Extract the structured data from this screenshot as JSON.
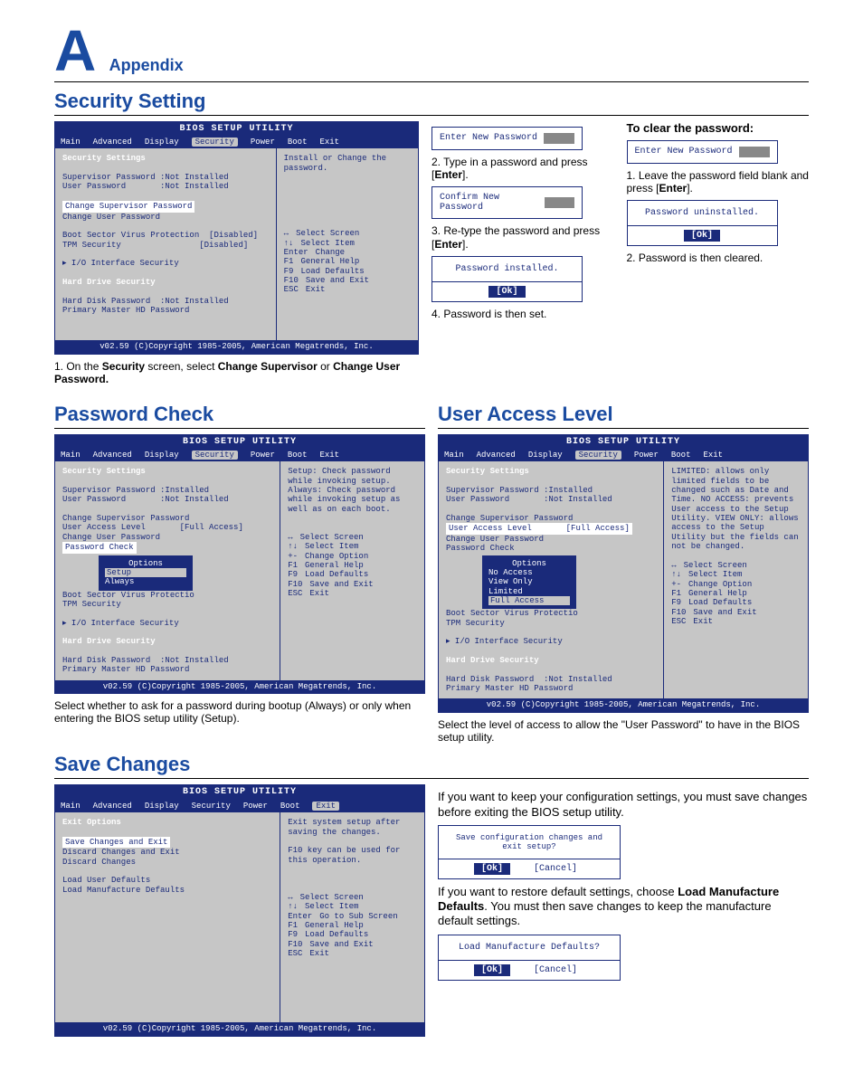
{
  "appendix": {
    "letter": "A",
    "label": "Appendix"
  },
  "sections": {
    "security": "Security Setting",
    "passwordCheck": "Password Check",
    "userAccess": "User Access Level",
    "saveChanges": "Save Changes"
  },
  "bios": {
    "title": "BIOS SETUP UTILITY",
    "menus": [
      "Main",
      "Advanced",
      "Display",
      "Security",
      "Power",
      "Boot",
      "Exit"
    ],
    "copyright": "v02.59 (C)Copyright 1985-2005, American Megatrends, Inc.",
    "keys": {
      "selectScreen": "Select Screen",
      "selectItem": "Select Item",
      "change": "Change",
      "changeOption": "Change Option",
      "generalHelp": "General Help",
      "loadDefaults": "Load Defaults",
      "saveExit": "Save and Exit",
      "exit": "Exit",
      "goSub": "Go to Sub Screen"
    }
  },
  "securityBios": {
    "heading": "Security Settings",
    "rows": [
      {
        "k": "Supervisor Password",
        "v": ":Not Installed"
      },
      {
        "k": "User Password",
        "v": ":Not Installed"
      }
    ],
    "change": [
      "Change Supervisor Password",
      "Change User Password"
    ],
    "bootRows": [
      {
        "k": "Boot Sector Virus Protection",
        "v": "[Disabled]"
      },
      {
        "k": "TPM Security",
        "v": "[Disabled]"
      }
    ],
    "io": "▸ I/O Interface Security",
    "hd": "Hard Drive Security",
    "hdRows": [
      {
        "k": "Hard Disk Password",
        "v": ":Not Installed"
      },
      {
        "k": "Primary Master HD Password",
        "v": ""
      }
    ],
    "help": "Install or Change the password."
  },
  "securityCaption": "1. On the Security screen, select Change Supervisor or Change User Password.",
  "dialogs": {
    "enterNew": "Enter New Password",
    "confirmNew": "Confirm New Password",
    "installed": "Password installed.",
    "uninstalled": "Password uninstalled.",
    "ok": "[Ok]",
    "cancel": "[Cancel]"
  },
  "steps": {
    "s2": "2. Type in a password and press [Enter].",
    "s3": "3. Re-type the password and press [Enter].",
    "s4": "4. Password is then set.",
    "clearHead": "To clear the password:",
    "c1": "1. Leave the password field blank and press [Enter].",
    "c2": "2. Password is then cleared."
  },
  "pwCheckBios": {
    "rows": [
      {
        "k": "Supervisor Password",
        "v": ":Installed"
      },
      {
        "k": "User Password",
        "v": ":Not Installed"
      }
    ],
    "items": [
      "Change Supervisor Password",
      "User Access Level",
      "Change User Password",
      "Password Check"
    ],
    "uaVal": "[Full Access]",
    "popup": {
      "title": "Options",
      "opts": [
        "Setup",
        "Always"
      ]
    },
    "boot": [
      "Boot Sector Virus Protectio",
      "TPM Security"
    ],
    "help": "Setup: Check password while invoking setup. Always: Check password while invoking setup as well as on each boot."
  },
  "pwCheckCaption": "Select whether to ask for a password during bootup (Always) or only when entering the BIOS setup utility (Setup).",
  "uaBios": {
    "popup": {
      "title": "Options",
      "opts": [
        "No Access",
        "View Only",
        "Limited",
        "Full Access"
      ]
    },
    "help": "LIMITED: allows only limited fields to be changed such as Date and Time. NO ACCESS: prevents User access to the Setup Utility. VIEW ONLY: allows access to the Setup Utility but the fields can not be changed."
  },
  "uaCaption": "Select the level of access to allow the \"User Password\" to have in the BIOS setup utility.",
  "saveBios": {
    "heading": "Exit Options",
    "items": [
      "Save Changes and Exit",
      "Discard Changes and Exit",
      "Discard Changes",
      "",
      "Load User Defaults",
      "Load Manufacture Defaults"
    ],
    "help1": "Exit system setup after saving the changes.",
    "help2": "F10 key can be used for this operation."
  },
  "saveNotes": {
    "n1": "If you want to keep your configuration settings, you must save changes before exiting the BIOS setup utility.",
    "n2": "If you want to restore default settings, choose Load Manufacture Defaults. You must then save changes to keep the manufacture default settings."
  },
  "saveDialogs": {
    "confirm": "Save configuration changes and exit setup?",
    "load": "Load Manufacture Defaults?"
  }
}
